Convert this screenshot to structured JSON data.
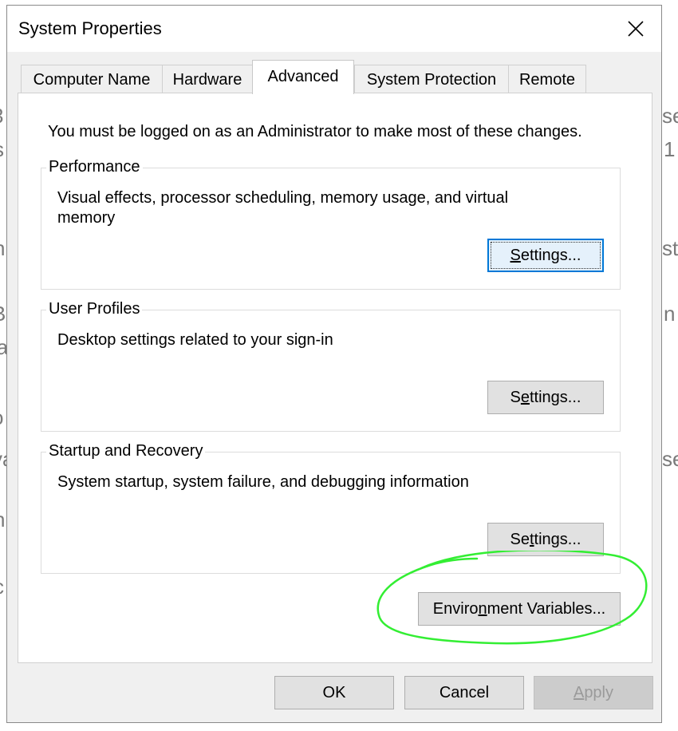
{
  "background_fragments": [
    {
      "text": "3"
    },
    {
      "text": "s"
    },
    {
      "text": "se"
    },
    {
      "text": "1"
    },
    {
      "text": "n"
    },
    {
      "text": "sti"
    },
    {
      "text": "B"
    },
    {
      "text": "n"
    },
    {
      "text": "ia"
    },
    {
      "text": "o"
    },
    {
      "text": "va"
    },
    {
      "text": "se"
    },
    {
      "text": "n"
    },
    {
      "text": "c"
    }
  ],
  "dialog": {
    "title": "System Properties",
    "close_icon": "close-icon",
    "tabs": [
      {
        "label": "Computer Name"
      },
      {
        "label": "Hardware"
      },
      {
        "label": "Advanced",
        "active": true
      },
      {
        "label": "System Protection"
      },
      {
        "label": "Remote"
      }
    ],
    "notice": "You must be logged on as an Administrator to make most of these changes.",
    "groups": [
      {
        "title": "Performance",
        "description": "Visual effects, processor scheduling, memory usage, and virtual memory",
        "button": {
          "pre": "",
          "accel": "S",
          "post": "ettings..."
        }
      },
      {
        "title": "User Profiles",
        "description": "Desktop settings related to your sign-in",
        "button": {
          "pre": "S",
          "accel": "e",
          "post": "ttings..."
        }
      },
      {
        "title": "Startup and Recovery",
        "description": "System startup, system failure, and debugging information",
        "button": {
          "pre": "Se",
          "accel": "t",
          "post": "tings..."
        }
      }
    ],
    "env_button": {
      "pre": "Enviro",
      "accel": "n",
      "post": "ment Variables..."
    },
    "footer": {
      "ok": "OK",
      "cancel": "Cancel",
      "apply": {
        "pre": "",
        "accel": "A",
        "post": "pply"
      }
    }
  },
  "colors": {
    "annotation": "#33ee33",
    "focus_border": "#0078d7",
    "window_bg": "#f0f0f0"
  }
}
